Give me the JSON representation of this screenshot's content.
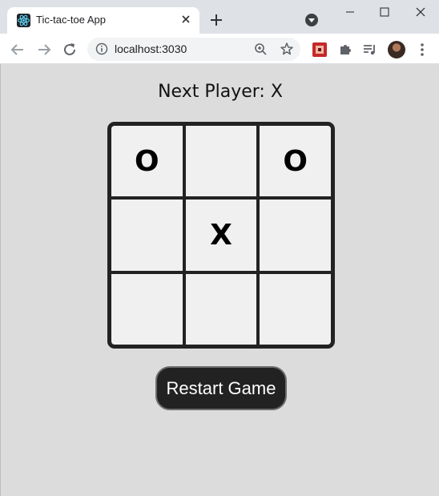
{
  "browser": {
    "tab_title": "Tic-tac-toe App",
    "url": "localhost:3030",
    "icons": [
      "react-favicon-icon",
      "close-icon",
      "plus-icon",
      "tab-search-icon",
      "minimize-icon",
      "maximize-icon",
      "window-close-icon",
      "back-icon",
      "forward-icon",
      "reload-icon",
      "info-icon",
      "zoom-icon",
      "star-icon",
      "extension-icon",
      "puzzle-icon",
      "media-icon",
      "avatar",
      "menu-icon"
    ]
  },
  "game": {
    "status": "Next Player: X",
    "board": [
      "O",
      "",
      "O",
      "",
      "X",
      "",
      "",
      "",
      ""
    ],
    "restart_label": "Restart Game"
  }
}
